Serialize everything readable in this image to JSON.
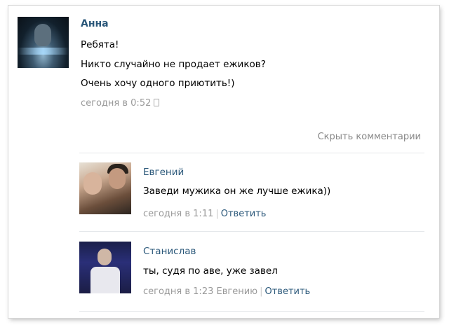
{
  "post": {
    "author": "Анна",
    "lines": [
      "Ребята!",
      "Никто случайно не продает ежиков?",
      "Очень хочу одного приютить!)"
    ],
    "time": "сегодня в 0:52",
    "device_icon": "phone-icon"
  },
  "hide_comments_label": "Скрыть комментарии",
  "replies": [
    {
      "author": "Евгений",
      "text": "Заведи мужика он же лучше ежика))",
      "time": "сегодня в 1:11",
      "reply_label": "Ответить"
    },
    {
      "author": "Станислав",
      "text": "ты, судя по аве, уже завел",
      "time": "сегодня в 1:23",
      "reply_to": "Евгению",
      "reply_label": "Ответить"
    }
  ],
  "colors": {
    "link": "#2b587a",
    "meta": "#999999",
    "divider": "#e4e7ea"
  }
}
